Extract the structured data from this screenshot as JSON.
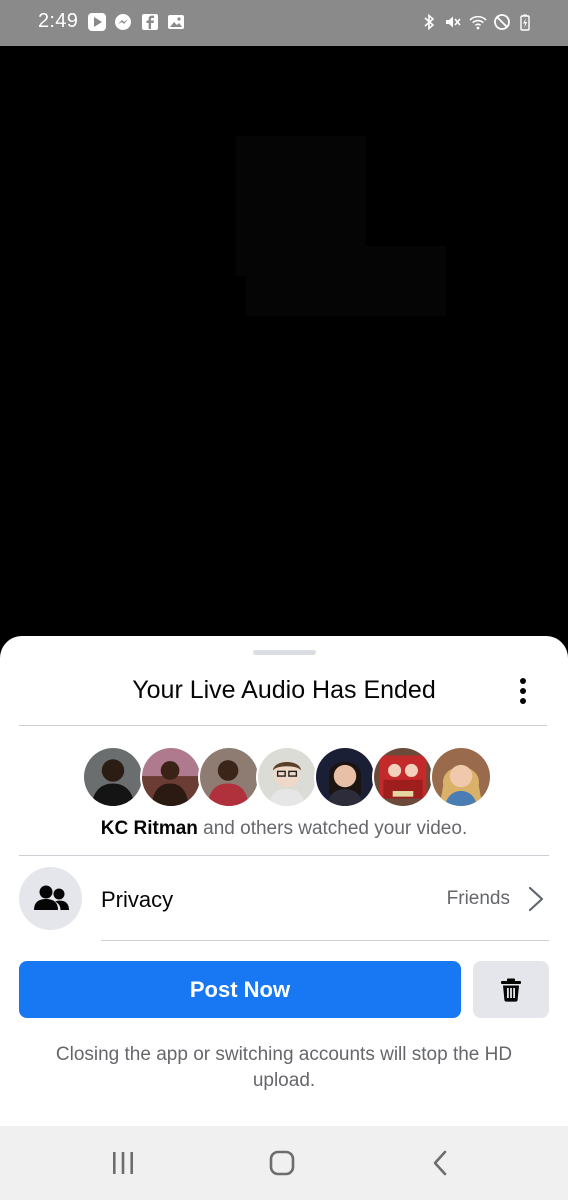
{
  "status_bar": {
    "time": "2:49",
    "left_icons": [
      "play-store-icon",
      "messenger-icon",
      "facebook-icon",
      "gallery-icon"
    ],
    "right_icons": [
      "bluetooth-icon",
      "mute-icon",
      "wifi-icon",
      "do-not-disturb-icon",
      "battery-icon"
    ]
  },
  "sheet": {
    "title": "Your Live Audio Has Ended",
    "viewers": {
      "avatar_count": 7,
      "highlight_name": "KC Ritman",
      "suffix": " and others watched your video."
    },
    "privacy": {
      "label": "Privacy",
      "value": "Friends",
      "icon": "friends-icon"
    },
    "post_button_label": "Post Now",
    "delete_icon": "trash-icon",
    "notice": "Closing the app or switching accounts will stop the HD upload."
  },
  "nav_bar": {
    "buttons": [
      "recent-apps-icon",
      "home-icon",
      "back-icon"
    ]
  },
  "colors": {
    "accent": "#1877f2",
    "status_bar_bg": "#8a8a8a",
    "secondary_text": "#65676b",
    "divider": "#ccd0d5",
    "grey_button": "#e4e6eb"
  }
}
